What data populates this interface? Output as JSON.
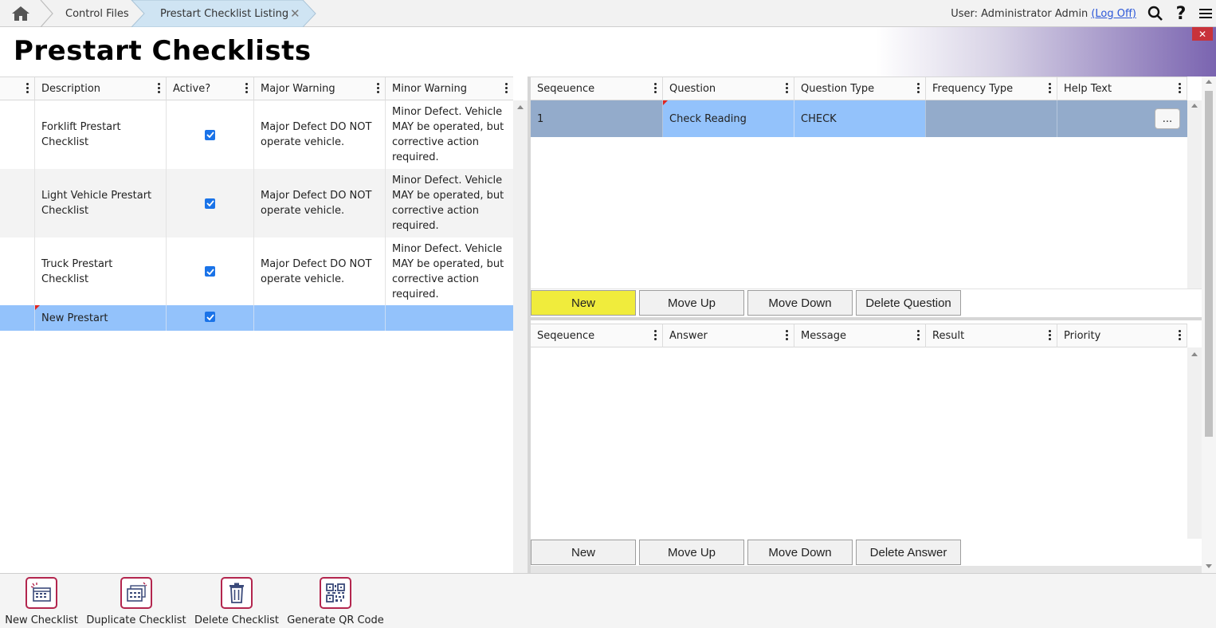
{
  "breadcrumbs": [
    {
      "label": "Control Files"
    },
    {
      "label": "Prestart Checklist Listing"
    }
  ],
  "user": {
    "label": "User: Administrator Admin",
    "logoff": "(Log Off)"
  },
  "page_title": "Prestart Checklists",
  "close_label": "✕",
  "checklists": {
    "headers": [
      "Description",
      "Active?",
      "Major Warning",
      "Minor Warning"
    ],
    "rows": [
      {
        "description": "Forklift Prestart Checklist",
        "active": true,
        "major": "Major Defect DO NOT operate vehicle.",
        "minor": "Minor Defect. Vehicle MAY be operated, but corrective action required."
      },
      {
        "description": "Light Vehicle Prestart Checklist",
        "active": true,
        "major": "Major Defect DO NOT operate vehicle.",
        "minor": "Minor Defect. Vehicle MAY be operated, but corrective action required."
      },
      {
        "description": "Truck Prestart Checklist",
        "active": true,
        "major": "Major Defect DO NOT operate vehicle.",
        "minor": "Minor Defect. Vehicle MAY be operated, but corrective action required."
      },
      {
        "description": "New Prestart",
        "active": true,
        "major": "",
        "minor": ""
      }
    ]
  },
  "questions": {
    "headers": [
      "Seqeuence",
      "Question",
      "Question Type",
      "Frequency Type",
      "Help Text"
    ],
    "rows": [
      {
        "sequence": "1",
        "question": "Check Reading",
        "type": "CHECK",
        "frequency": "",
        "help_button": "..."
      }
    ],
    "buttons": {
      "new": "New",
      "move_up": "Move Up",
      "move_down": "Move Down",
      "delete": "Delete Question"
    }
  },
  "answers": {
    "headers": [
      "Seqeuence",
      "Answer",
      "Message",
      "Result",
      "Priority"
    ],
    "rows": [],
    "buttons": {
      "new": "New",
      "move_up": "Move Up",
      "move_down": "Move Down",
      "delete": "Delete Answer"
    }
  },
  "toolbar": {
    "new_checklist": "New Checklist",
    "duplicate_checklist": "Duplicate Checklist",
    "delete_checklist": "Delete Checklist",
    "generate_qr": "Generate QR Code"
  },
  "colors": {
    "accent_purple": "#7a64b0",
    "selected_row": "#93c2fb",
    "selected_row_dark": "#93abcb",
    "new_button_yellow": "#f0ec3c",
    "toolbar_icon_border": "#b3264e",
    "checkbox_blue": "#1a73e8"
  },
  "icons": [
    "home-icon",
    "search-icon",
    "help-icon",
    "menu-icon",
    "close-icon",
    "kebab-icon",
    "checkbox-icon",
    "new-checklist-icon",
    "duplicate-checklist-icon",
    "delete-checklist-icon",
    "qr-code-icon"
  ]
}
